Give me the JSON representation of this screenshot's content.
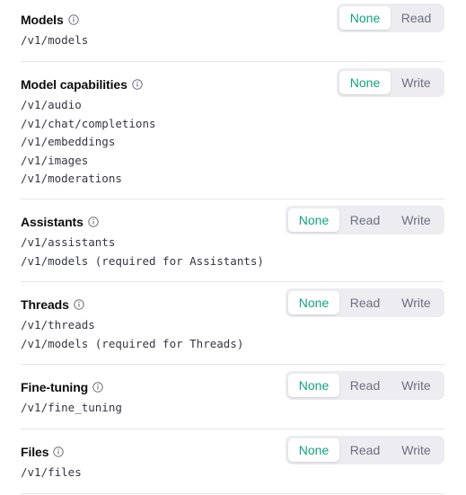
{
  "sections": [
    {
      "title": "Models",
      "paths": [
        "/v1/models"
      ],
      "options": [
        "None",
        "Read"
      ],
      "selected": "None"
    },
    {
      "title": "Model capabilities",
      "paths": [
        "/v1/audio",
        "/v1/chat/completions",
        "/v1/embeddings",
        "/v1/images",
        "/v1/moderations"
      ],
      "options": [
        "None",
        "Write"
      ],
      "selected": "None"
    },
    {
      "title": "Assistants",
      "paths": [
        "/v1/assistants",
        "/v1/models (required for Assistants)"
      ],
      "options": [
        "None",
        "Read",
        "Write"
      ],
      "selected": "None"
    },
    {
      "title": "Threads",
      "paths": [
        "/v1/threads",
        "/v1/models (required for Threads)"
      ],
      "options": [
        "None",
        "Read",
        "Write"
      ],
      "selected": "None"
    },
    {
      "title": "Fine-tuning",
      "paths": [
        "/v1/fine_tuning"
      ],
      "options": [
        "None",
        "Read",
        "Write"
      ],
      "selected": "None"
    },
    {
      "title": "Files",
      "paths": [
        "/v1/files"
      ],
      "options": [
        "None",
        "Read",
        "Write"
      ],
      "selected": "None"
    }
  ],
  "icons": {
    "info": "info-icon"
  },
  "colors": {
    "active_text": "#10a37f",
    "segment_bg": "#ececf1",
    "inactive_text": "#6e6e80",
    "divider": "#e6e6e6"
  }
}
